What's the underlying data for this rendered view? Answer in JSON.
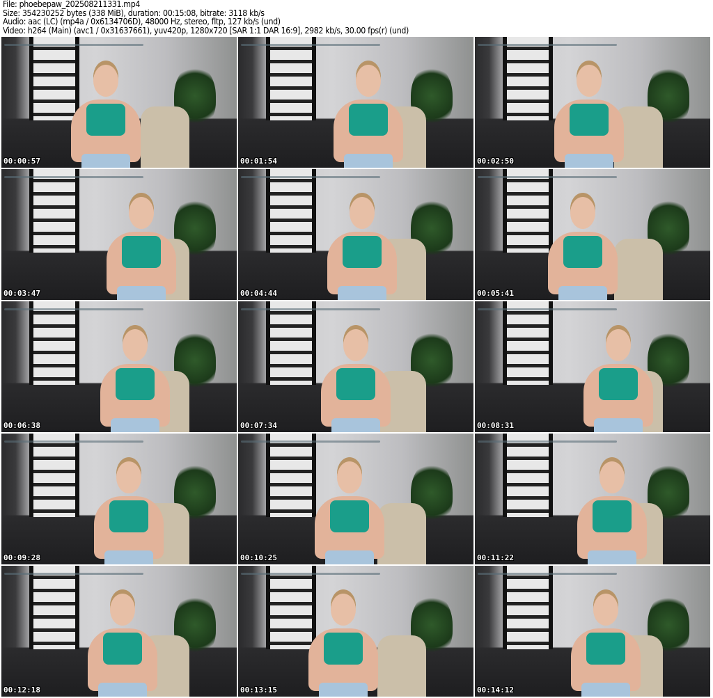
{
  "header": {
    "file": "File: phoebepaw_202508211331.mp4",
    "size": "Size: 354230252 bytes (338 MiB), duration: 00:15:08, bitrate: 3118 kb/s",
    "audio": "Audio: aac (LC) (mp4a / 0x6134706D), 48000 Hz, stereo, fltp, 127 kb/s (und)",
    "video": "Video: h264 (Main) (avc1 / 0x31637661), yuv420p, 1280x720 [SAR 1:1 DAR 16:9], 2982 kb/s, 30.00 fps(r) (und)"
  },
  "thumbnails": [
    "00:00:57",
    "00:01:54",
    "00:02:50",
    "00:03:47",
    "00:04:44",
    "00:05:41",
    "00:06:38",
    "00:07:34",
    "00:08:31",
    "00:09:28",
    "00:10:25",
    "00:11:22",
    "00:12:18",
    "00:13:15",
    "00:14:12"
  ]
}
